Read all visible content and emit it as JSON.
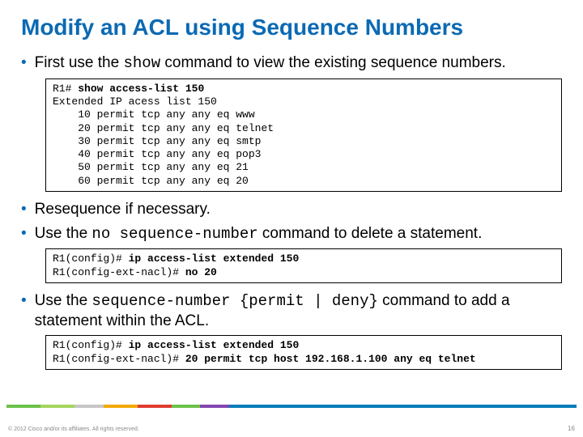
{
  "title": "Modify an ACL using Sequence Numbers",
  "bullets": {
    "b1_pre": "First use the ",
    "b1_cmd": "show",
    "b1_post": " command to view the existing sequence numbers.",
    "b2": "Resequence if necessary.",
    "b3_pre": "Use the ",
    "b3_cmd": "no sequence-number",
    "b3_post": " command to delete a statement.",
    "b4_pre": "Use the ",
    "b4_cmd": "sequence-number {permit | deny}",
    "b4_post": " command to add a statement within the ACL."
  },
  "code1": {
    "l1a": "R1# ",
    "l1b": "show access-list 150",
    "l2": "Extended IP acess list 150",
    "l3": "    10 permit tcp any any eq www",
    "l4": "    20 permit tcp any any eq telnet",
    "l5": "    30 permit tcp any any eq smtp",
    "l6": "    40 permit tcp any any eq pop3",
    "l7": "    50 permit tcp any any eq 21",
    "l8": "    60 permit tcp any any eq 20"
  },
  "code2": {
    "l1a": "R1(config)# ",
    "l1b": "ip access-list extended 150",
    "l2a": "R1(config-ext-nacl)# ",
    "l2b": "no 20"
  },
  "code3": {
    "l1a": "R1(config)# ",
    "l1b": "ip access-list extended 150",
    "l2a": "R1(config-ext-nacl)# ",
    "l2b": "20 permit tcp host 192.168.1.100 any eq telnet"
  },
  "footer": {
    "copyright": "© 2012 Cisco and/or its affiliates. All rights reserved.",
    "page": "16"
  }
}
